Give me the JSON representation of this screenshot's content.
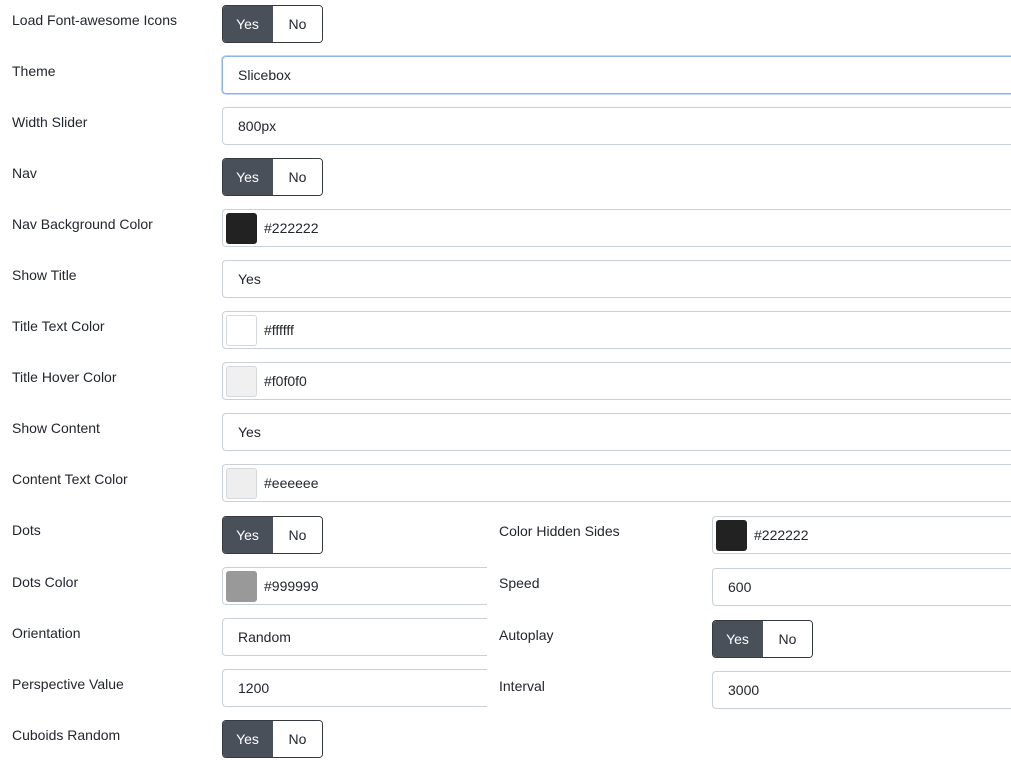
{
  "toggle": {
    "yes": "Yes",
    "no": "No"
  },
  "rows": {
    "load_fa": {
      "label": "Load Font-awesome Icons",
      "value": "Yes"
    },
    "theme": {
      "label": "Theme",
      "value": "Slicebox"
    },
    "width_slider": {
      "label": "Width Slider",
      "value": "800px"
    },
    "nav": {
      "label": "Nav",
      "value": "Yes"
    },
    "nav_bg": {
      "label": "Nav Background Color",
      "value": "#222222",
      "color": "#222222"
    },
    "show_title": {
      "label": "Show Title",
      "value": "Yes"
    },
    "title_text_color": {
      "label": "Title Text Color",
      "value": "#ffffff",
      "color": "#ffffff"
    },
    "title_hover_color": {
      "label": "Title Hover Color",
      "value": "#f0f0f0",
      "color": "#f0f0f0"
    },
    "show_content": {
      "label": "Show Content",
      "value": "Yes"
    },
    "content_text_color": {
      "label": "Content Text Color",
      "value": "#eeeeee",
      "color": "#eeeeee"
    },
    "dots": {
      "label": "Dots",
      "value": "Yes"
    },
    "dots_color": {
      "label": "Dots Color",
      "value": "#999999",
      "color": "#999999"
    },
    "orientation": {
      "label": "Orientation",
      "value": "Random"
    },
    "perspective": {
      "label": "Perspective Value",
      "value": "1200"
    },
    "cuboids_random": {
      "label": "Cuboids Random",
      "value": "Yes"
    },
    "color_hidden_sides": {
      "label": "Color Hidden Sides",
      "value": "#222222",
      "color": "#222222"
    },
    "speed": {
      "label": "Speed",
      "value": "600"
    },
    "autoplay": {
      "label": "Autoplay",
      "value": "Yes"
    },
    "interval": {
      "label": "Interval",
      "value": "3000"
    }
  }
}
